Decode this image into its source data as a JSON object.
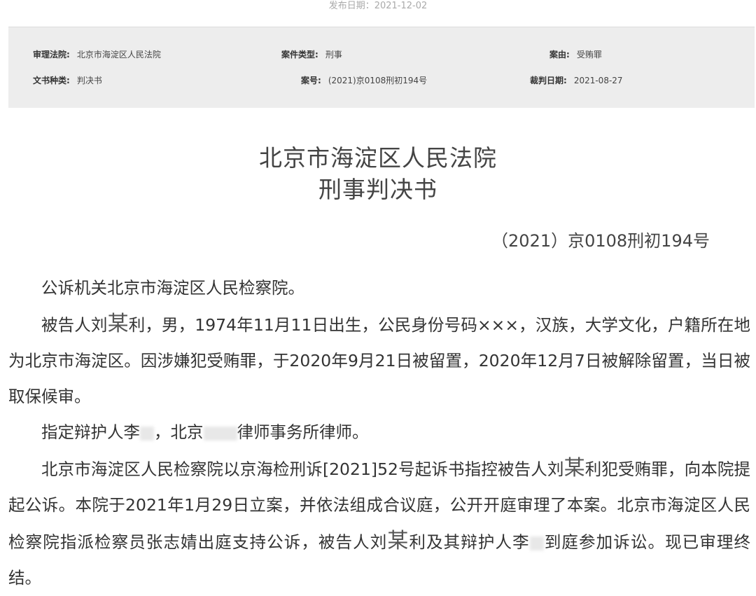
{
  "publish_date": "发布日期：2021-12-02",
  "meta": {
    "court_label": "审理法院:",
    "court": "北京市海淀区人民法院",
    "case_type_label": "案件类型:",
    "case_type": "刑事",
    "cause_label": "案由:",
    "cause": "受贿罪",
    "doc_type_label": "文书种类:",
    "doc_type": "判决书",
    "case_no_label": "案号:",
    "case_no": "(2021)京0108刑初194号",
    "judge_date_label": "裁判日期:",
    "judge_date": "2021-08-27"
  },
  "doc": {
    "title1": "北京市海淀区人民法院",
    "title2": "刑事判决书",
    "case_no": "（2021）京0108刑初194号",
    "p1": "公诉机关北京市海淀区人民检察院。",
    "p2_a": "被告人刘",
    "mou": "某",
    "p2_b": "利，男，1974年11月11日出生，公民身份号码×××，汉族，大学文化，户籍所在地为北京市海淀区。因涉嫌犯受贿罪，于2020年9月21日被留置，2020年12月7日被解除留置，当日被取保候审。",
    "p3_a": "指定辩护人李",
    "p3_b": "，北京",
    "p3_c": "律师事务所律师。",
    "p4_a": "北京市海淀区人民检察院以京海检刑诉[2021]52号起诉书指控被告人刘",
    "p4_b": "利犯受贿罪，向本院提起公诉。本院于2021年1月29日立案，并依法组成合议庭，公开开庭审理了本案。北京市海淀区人民检察院指派检察员张志婧出庭支持公诉，被告人刘",
    "p4_c": "利及其辩护人李",
    "p4_d": "到庭参加诉讼。现已审理终结。"
  }
}
